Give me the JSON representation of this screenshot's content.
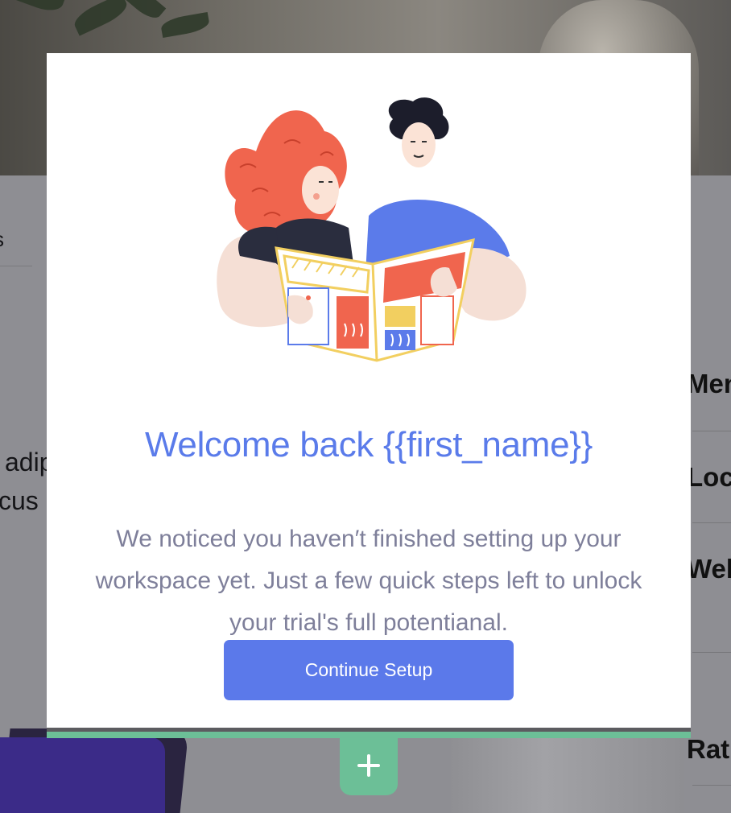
{
  "background": {
    "left_fragments": [
      "adip",
      "cus"
    ],
    "left_partial_top": "s",
    "right_menu": [
      "Men",
      "Loc",
      "Wel",
      "Rat"
    ]
  },
  "modal": {
    "illustration": "two-people-reading-newspaper",
    "title": "Welcome back {{first_name}}",
    "body": "We noticed you haven′t finished setting up your workspace yet. Just a few quick steps left to unlock your trial's full potentianal.",
    "button_label": "Continue Setup"
  },
  "builder": {
    "add_icon": "plus-icon"
  },
  "colors": {
    "title": "#5a7bea",
    "button": "#5b79ea",
    "body_text": "#7e7f9a",
    "accent_green": "#6cbf97",
    "overlay": "#8e8e93"
  }
}
